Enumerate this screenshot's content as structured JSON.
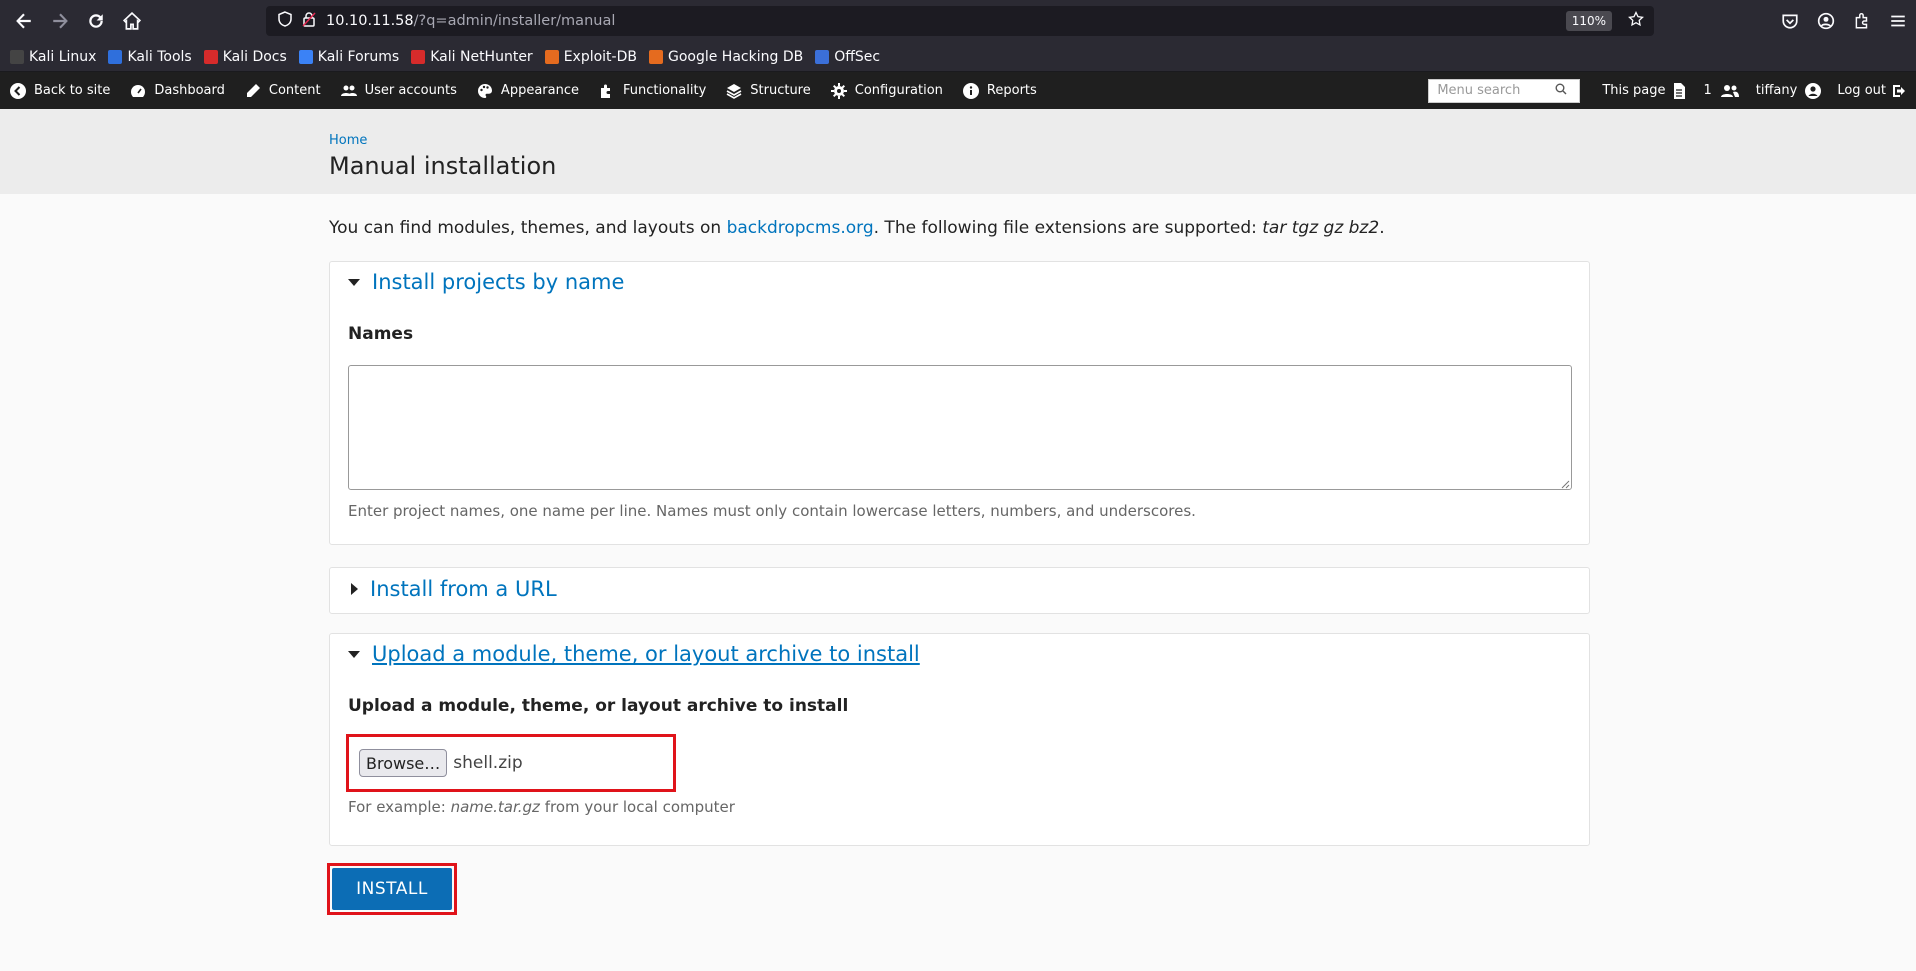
{
  "browser": {
    "url_host": "10.10.11.58",
    "url_path": "/?q=admin/installer/manual",
    "zoom": "110%"
  },
  "bookmarks": [
    {
      "label": "Kali Linux",
      "color": "#444444"
    },
    {
      "label": "Kali Tools",
      "color": "#2f6fdc"
    },
    {
      "label": "Kali Docs",
      "color": "#d62b2b"
    },
    {
      "label": "Kali Forums",
      "color": "#3b82f6"
    },
    {
      "label": "Kali NetHunter",
      "color": "#d62b2b"
    },
    {
      "label": "Exploit-DB",
      "color": "#e56b1f"
    },
    {
      "label": "Google Hacking DB",
      "color": "#e56b1f"
    },
    {
      "label": "OffSec",
      "color": "#3b6fd8"
    }
  ],
  "adminbar": {
    "items": [
      {
        "label": "Back to site",
        "icon": "back-arrow-icon"
      },
      {
        "label": "Dashboard",
        "icon": "dashboard-icon"
      },
      {
        "label": "Content",
        "icon": "pencil-icon"
      },
      {
        "label": "User accounts",
        "icon": "users-icon"
      },
      {
        "label": "Appearance",
        "icon": "palette-icon"
      },
      {
        "label": "Functionality",
        "icon": "puzzle-icon"
      },
      {
        "label": "Structure",
        "icon": "layers-icon"
      },
      {
        "label": "Configuration",
        "icon": "gear-icon"
      },
      {
        "label": "Reports",
        "icon": "info-icon"
      }
    ],
    "search_placeholder": "Menu search",
    "this_page": "This page",
    "user_count": "1",
    "username": "tiffany",
    "logout": "Log out"
  },
  "page": {
    "breadcrumb_home": "Home",
    "title": "Manual installation",
    "intro_prefix": "You can find modules, themes, and layouts on ",
    "intro_link": "backdropcms.org",
    "intro_middle": ". The following file extensions are supported: ",
    "intro_exts": "tar tgz gz bz2",
    "intro_suffix": "."
  },
  "fieldsets": {
    "by_name": {
      "legend": "Install projects by name",
      "label": "Names",
      "value": "",
      "help": "Enter project names, one name per line. Names must only contain lowercase letters, numbers, and underscores."
    },
    "by_url": {
      "legend": "Install from a URL"
    },
    "upload": {
      "legend": "Upload a module, theme, or layout archive to install",
      "label": "Upload a module, theme, or layout archive to install",
      "browse": "Browse…",
      "file_name": "shell.zip",
      "help_prefix": "For example: ",
      "help_example": "name.tar.gz",
      "help_suffix": " from your local computer"
    }
  },
  "install_button": "INSTALL",
  "colors": {
    "link": "#0074bd",
    "highlight": "#e0131a",
    "install": "#0c6db5"
  }
}
